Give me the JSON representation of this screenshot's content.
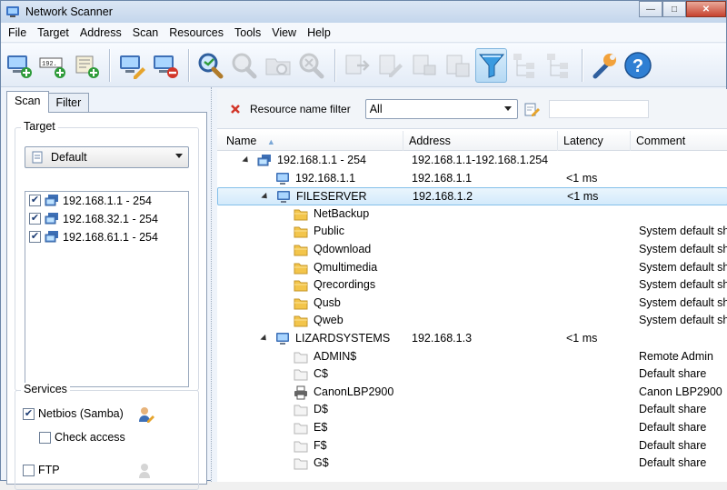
{
  "window": {
    "title": "Network Scanner"
  },
  "menu": [
    "File",
    "Target",
    "Address",
    "Scan",
    "Resources",
    "Tools",
    "View",
    "Help"
  ],
  "toolbar_icons": [
    "add-computer-icon",
    "add-ip-range-icon",
    "add-from-file-icon",
    "computer-edit-icon",
    "computer-remove-icon",
    "scan-icon",
    "find-icon",
    "find-folder-icon",
    "stop-icon",
    "export-icon",
    "export-edit-icon",
    "export-list-icon",
    "export-doc-icon",
    "filter-icon",
    "tree-expand-icon",
    "tree-collapse-icon",
    "settings-wrench-icon",
    "help-icon"
  ],
  "left": {
    "tabs": [
      "Scan",
      "Filter"
    ],
    "target_group": "Target",
    "target_select": "Default",
    "targets": [
      {
        "label": "192.168.1.1 - 254",
        "checked": true
      },
      {
        "label": "192.168.32.1 - 254",
        "checked": true
      },
      {
        "label": "192.168.61.1 - 254",
        "checked": true
      }
    ],
    "services_group": "Services",
    "services": [
      {
        "label": "Netbios (Samba)",
        "checked": true
      },
      {
        "label": "Check access",
        "checked": false
      },
      {
        "label": "FTP",
        "checked": false
      }
    ]
  },
  "filter": {
    "label": "Resource name filter",
    "value": "All"
  },
  "columns": [
    "Name",
    "Address",
    "Latency",
    "Comment"
  ],
  "rows": [
    {
      "name": "192.168.1.1 - 254",
      "address": "192.168.1.1-192.168.1.254",
      "latency": "",
      "comment": "",
      "level": 0,
      "icon": "network-range-icon",
      "expander": true
    },
    {
      "name": "192.168.1.1",
      "address": "192.168.1.1",
      "latency": "<1 ms",
      "comment": "",
      "level": 1,
      "icon": "computer-icon",
      "expander": false
    },
    {
      "name": "FILESERVER",
      "address": "192.168.1.2",
      "latency": "<1 ms",
      "comment": "",
      "level": 1,
      "icon": "computer-icon",
      "expander": true,
      "selected": true
    },
    {
      "name": "NetBackup",
      "address": "",
      "latency": "",
      "comment": "",
      "level": 2,
      "icon": "folder-icon"
    },
    {
      "name": "Public",
      "address": "",
      "latency": "",
      "comment": "System default sha",
      "level": 2,
      "icon": "folder-icon"
    },
    {
      "name": "Qdownload",
      "address": "",
      "latency": "",
      "comment": "System default sha",
      "level": 2,
      "icon": "folder-icon"
    },
    {
      "name": "Qmultimedia",
      "address": "",
      "latency": "",
      "comment": "System default sha",
      "level": 2,
      "icon": "folder-icon"
    },
    {
      "name": "Qrecordings",
      "address": "",
      "latency": "",
      "comment": "System default sha",
      "level": 2,
      "icon": "folder-icon"
    },
    {
      "name": "Qusb",
      "address": "",
      "latency": "",
      "comment": "System default sha",
      "level": 2,
      "icon": "folder-icon"
    },
    {
      "name": "Qweb",
      "address": "",
      "latency": "",
      "comment": "System default sha",
      "level": 2,
      "icon": "folder-icon"
    },
    {
      "name": "LIZARDSYSTEMS",
      "address": "192.168.1.3",
      "latency": "<1 ms",
      "comment": "",
      "level": 1,
      "icon": "computer-icon",
      "expander": true
    },
    {
      "name": "ADMIN$",
      "address": "",
      "latency": "",
      "comment": "Remote Admin",
      "level": 2,
      "icon": "hidden-folder-icon"
    },
    {
      "name": "C$",
      "address": "",
      "latency": "",
      "comment": "Default share",
      "level": 2,
      "icon": "hidden-folder-icon"
    },
    {
      "name": "CanonLBP2900",
      "address": "",
      "latency": "",
      "comment": "Canon LBP2900",
      "level": 2,
      "icon": "printer-icon"
    },
    {
      "name": "D$",
      "address": "",
      "latency": "",
      "comment": "Default share",
      "level": 2,
      "icon": "hidden-folder-icon"
    },
    {
      "name": "E$",
      "address": "",
      "latency": "",
      "comment": "Default share",
      "level": 2,
      "icon": "hidden-folder-icon"
    },
    {
      "name": "F$",
      "address": "",
      "latency": "",
      "comment": "Default share",
      "level": 2,
      "icon": "hidden-folder-icon"
    },
    {
      "name": "G$",
      "address": "",
      "latency": "",
      "comment": "Default share",
      "level": 2,
      "icon": "hidden-folder-icon"
    }
  ]
}
